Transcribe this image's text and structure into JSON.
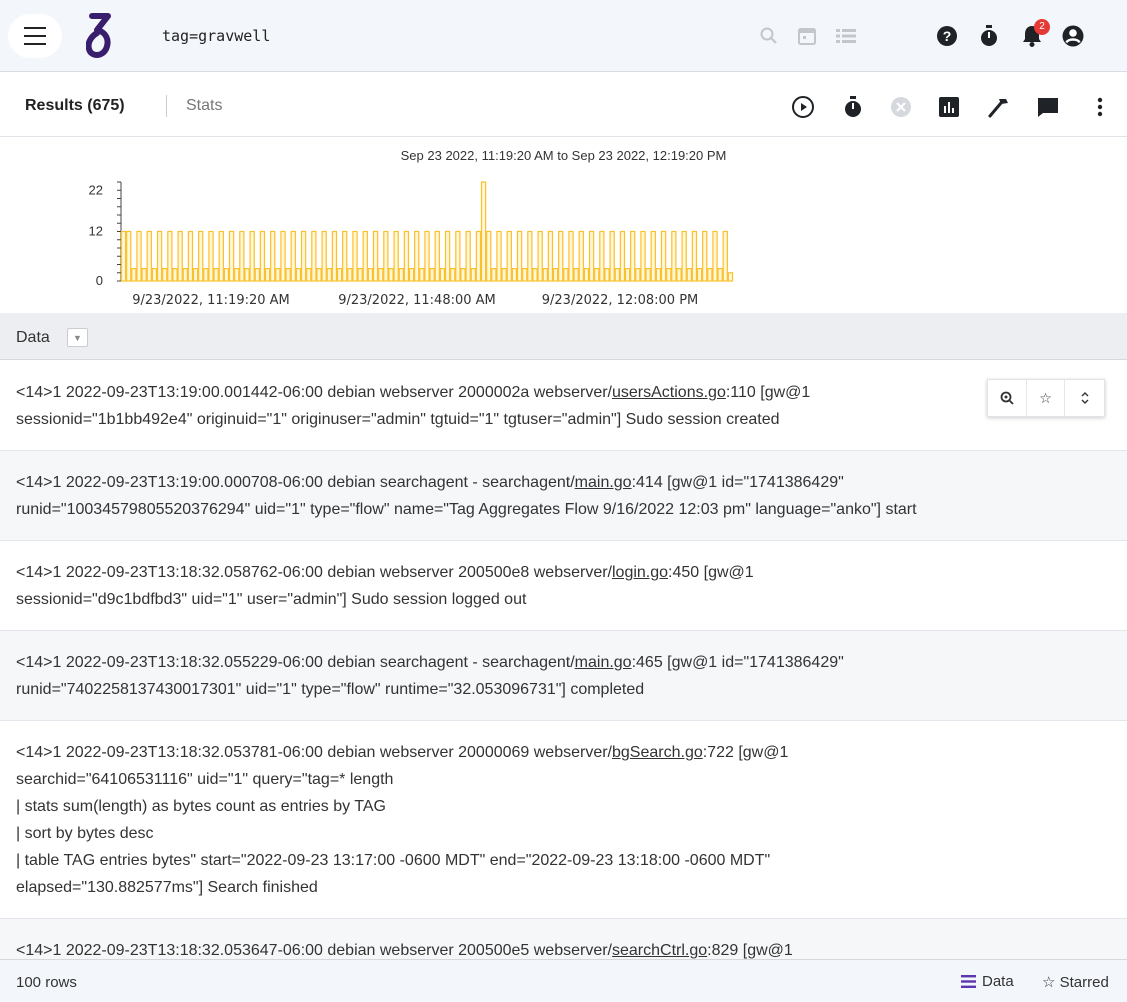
{
  "topbar": {
    "query": "tag=gravwell",
    "notification_count": "2"
  },
  "toolbar": {
    "results_label": "Results (675)",
    "stats_label": "Stats"
  },
  "chart_data": {
    "type": "bar",
    "title": "Sep 23 2022, 11:19:20 AM to Sep 23 2022, 12:19:20 PM",
    "y_ticks": [
      "22",
      "12",
      "0"
    ],
    "ylim": [
      0,
      24
    ],
    "x_tick_labels": [
      "9/23/2022, 11:19:20 AM",
      "9/23/2022, 11:48:00 AM",
      "9/23/2022, 12:08:00 PM"
    ],
    "bar_color": "#fbc02d",
    "values": [
      12,
      12,
      3,
      12,
      3,
      12,
      3,
      12,
      3,
      12,
      3,
      12,
      3,
      12,
      3,
      12,
      3,
      12,
      3,
      12,
      3,
      12,
      3,
      12,
      3,
      12,
      3,
      12,
      3,
      12,
      3,
      12,
      3,
      12,
      3,
      12,
      3,
      12,
      3,
      12,
      3,
      12,
      3,
      12,
      3,
      12,
      3,
      12,
      3,
      12,
      3,
      12,
      3,
      12,
      3,
      12,
      3,
      12,
      3,
      12,
      3,
      12,
      3,
      12,
      3,
      12,
      3,
      12,
      3,
      12,
      24,
      12,
      3,
      12,
      3,
      12,
      3,
      12,
      3,
      12,
      3,
      12,
      3,
      12,
      3,
      12,
      3,
      12,
      3,
      12,
      3,
      12,
      3,
      12,
      3,
      12,
      3,
      12,
      3,
      12,
      3,
      12,
      3,
      12,
      3,
      12,
      3,
      12,
      3,
      12,
      3,
      12,
      3,
      12,
      3,
      12,
      3,
      12,
      2
    ]
  },
  "data_header": {
    "label": "Data"
  },
  "rows": [
    {
      "lines": [
        [
          "<14>1 2022-09-23T13:19:00.001442-06:00 debian webserver 2000002a webserver/",
          "usersActions.go",
          ":110 [gw@1"
        ],
        [
          "sessionid=\"1b1bb492e4\" originuid=\"1\" originuser=\"admin\" tgtuid=\"1\" tgtuser=\"admin\"] Sudo session created"
        ]
      ]
    },
    {
      "lines": [
        [
          "<14>1 2022-09-23T13:19:00.000708-06:00 debian searchagent - searchagent/",
          "main.go",
          ":414 [gw@1 id=\"1741386429\""
        ],
        [
          "runid=\"10034579805520376294\" uid=\"1\" type=\"flow\" name=\"Tag Aggregates Flow 9/16/2022 12:03 pm\" language=\"anko\"] start"
        ]
      ]
    },
    {
      "lines": [
        [
          "<14>1 2022-09-23T13:18:32.058762-06:00 debian webserver 200500e8 webserver/",
          "login.go",
          ":450 [gw@1"
        ],
        [
          "sessionid=\"d9c1bdfbd3\" uid=\"1\" user=\"admin\"] Sudo session logged out"
        ]
      ]
    },
    {
      "lines": [
        [
          "<14>1 2022-09-23T13:18:32.055229-06:00 debian searchagent - searchagent/",
          "main.go",
          ":465 [gw@1 id=\"1741386429\""
        ],
        [
          "runid=\"7402258137430017301\" uid=\"1\" type=\"flow\" runtime=\"32.053096731\"] completed"
        ]
      ]
    },
    {
      "lines": [
        [
          "<14>1 2022-09-23T13:18:32.053781-06:00 debian webserver 20000069 webserver/",
          "bgSearch.go",
          ":722 [gw@1"
        ],
        [
          "searchid=\"64106531116\" uid=\"1\" query=\"tag=* length"
        ],
        [
          "| stats sum(length) as bytes count as entries by TAG"
        ],
        [
          "| sort by bytes desc"
        ],
        [
          "| table TAG entries bytes\" start=\"2022-09-23 13:17:00 -0600 MDT\" end=\"2022-09-23 13:18:00 -0600 MDT\""
        ],
        [
          "elapsed=\"130.882577ms\"] Search finished"
        ]
      ]
    },
    {
      "lines": [
        [
          "<14>1 2022-09-23T13:18:32.053647-06:00 debian webserver 200500e5 webserver/",
          "searchCtrl.go",
          ":829 [gw@1"
        ]
      ]
    }
  ],
  "footer": {
    "rows_label": "100 rows",
    "data_label": "Data",
    "starred_label": "☆ Starred"
  }
}
